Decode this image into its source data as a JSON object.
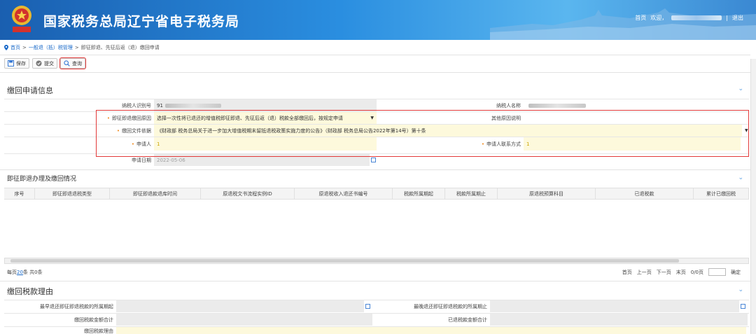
{
  "header": {
    "site_title": "国家税务总局辽宁省电子税务局",
    "nav_home": "首页",
    "nav_welcome": "欢迎，",
    "nav_logout": "退出",
    "nav_sep": "|"
  },
  "breadcrumb": {
    "home": "首页",
    "level1": "一般退（抵）税管理",
    "level2": "即征即退、先征后返（退）缴回申请",
    "sep": ">"
  },
  "toolbar": {
    "save_label": "保存",
    "submit_label": "提交",
    "query_label": "查询"
  },
  "section1": {
    "title": "缴回申请信息",
    "rows": {
      "taxpayer_id_label": "纳税人识别号",
      "taxpayer_id_value": "91",
      "taxpayer_name_label": "纳税人名称",
      "reason_label": "即征即退缴回原因",
      "reason_value": "选择一次性将已退还的增值税即征即退、先征后返（退）税款全部缴回后，按规定申请",
      "other_reason_label": "其他原因说明",
      "doc_basis_label": "缴回文件依据",
      "doc_basis_value": "《财政部 税务总局关于进一步加大增值税期末留抵退税政策实施力度的公告》（财政部 税务总局公告2022年第14号）第十条",
      "applicant_label": "申请人",
      "applicant_value": "1",
      "contact_label": "申请人联系方式",
      "contact_value": "1",
      "date_label": "申请日期",
      "date_value": "2022-05-06"
    }
  },
  "section2": {
    "title": "即征即退办理及缴回情况",
    "columns": [
      "序号",
      "即征即退退税类型",
      "即征即退款退库时间",
      "原退税文书流程实例ID",
      "原退税收入退还书编号",
      "税款所属期起",
      "税款所属期止",
      "原退税预算科目",
      "已退税款",
      "累计已缴回税"
    ],
    "pager": {
      "per_page_prefix": "每页",
      "per_page_value": "20",
      "per_page_suffix": "条 共0条",
      "first": "首页",
      "prev": "上一页",
      "next": "下一页",
      "last": "末页",
      "page_info": "0/0页",
      "confirm": "确定"
    }
  },
  "section3": {
    "title": "缴回税款理由",
    "earliest_label": "最早退还即征即退税款的所属期起",
    "latest_label": "最晚退还即征即退税款的所属期止",
    "return_total_label": "缴回税款金额合计",
    "refunded_total_label": "已退税款金额合计",
    "reason_label": "缴回税款理由"
  }
}
